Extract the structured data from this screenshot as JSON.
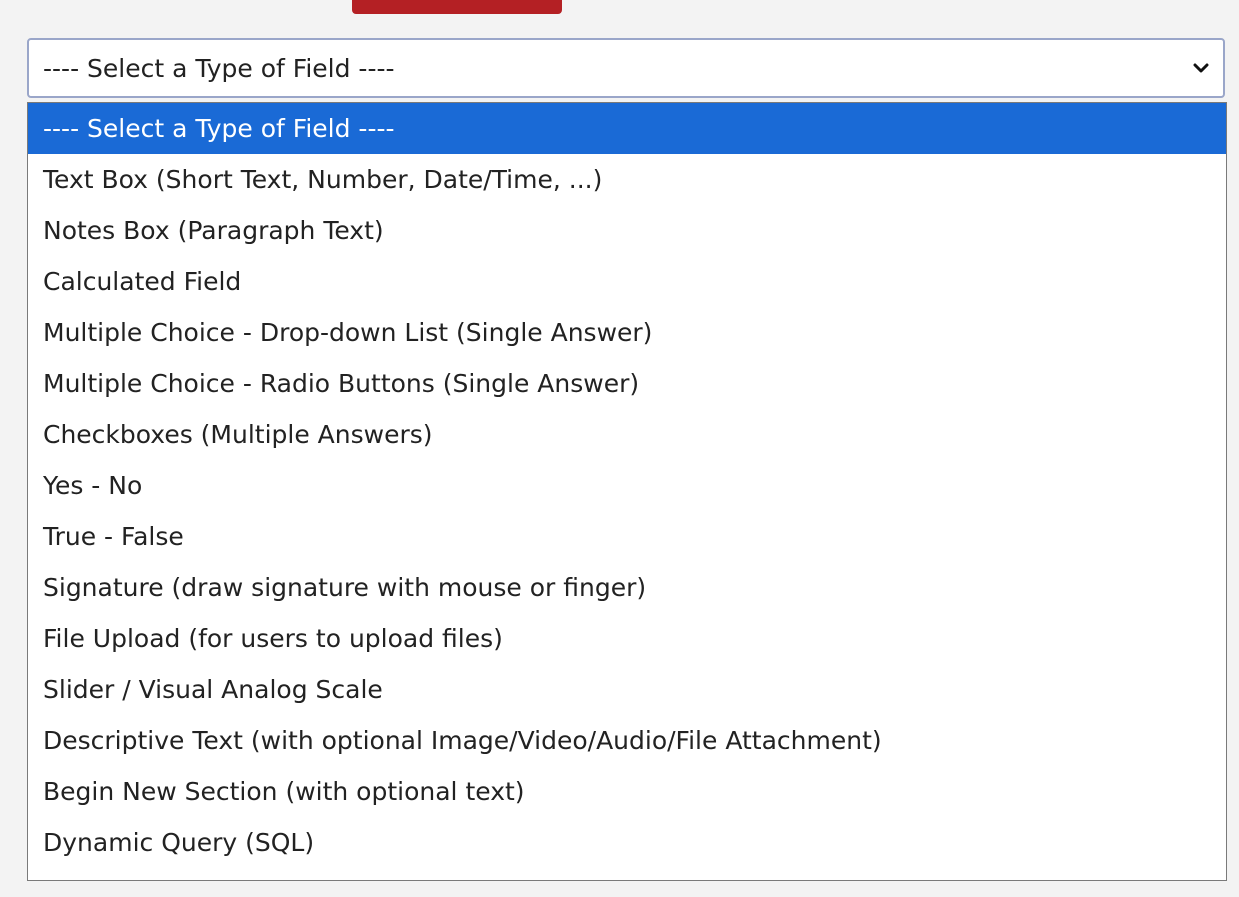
{
  "field_type_select": {
    "selected_label": "---- Select a Type of Field ----",
    "chevron_icon": "chevron-down-icon",
    "options": [
      {
        "label": "---- Select a Type of Field ----",
        "highlighted": true
      },
      {
        "label": "Text Box (Short Text, Number, Date/Time, ...)",
        "highlighted": false
      },
      {
        "label": "Notes Box (Paragraph Text)",
        "highlighted": false
      },
      {
        "label": "Calculated Field",
        "highlighted": false
      },
      {
        "label": "Multiple Choice - Drop-down List (Single Answer)",
        "highlighted": false
      },
      {
        "label": "Multiple Choice - Radio Buttons (Single Answer)",
        "highlighted": false
      },
      {
        "label": "Checkboxes (Multiple Answers)",
        "highlighted": false
      },
      {
        "label": "Yes - No",
        "highlighted": false
      },
      {
        "label": "True - False",
        "highlighted": false
      },
      {
        "label": "Signature (draw signature with mouse or finger)",
        "highlighted": false
      },
      {
        "label": "File Upload (for users to upload files)",
        "highlighted": false
      },
      {
        "label": "Slider / Visual Analog Scale",
        "highlighted": false
      },
      {
        "label": "Descriptive Text (with optional Image/Video/Audio/File Attachment)",
        "highlighted": false
      },
      {
        "label": "Begin New Section (with optional text)",
        "highlighted": false
      },
      {
        "label": "Dynamic Query (SQL)",
        "highlighted": false
      }
    ]
  },
  "colors": {
    "highlight": "#1a6ad6",
    "select_border": "#9aa6c9",
    "red_button": "#b42024",
    "background": "#f3f3f3"
  }
}
